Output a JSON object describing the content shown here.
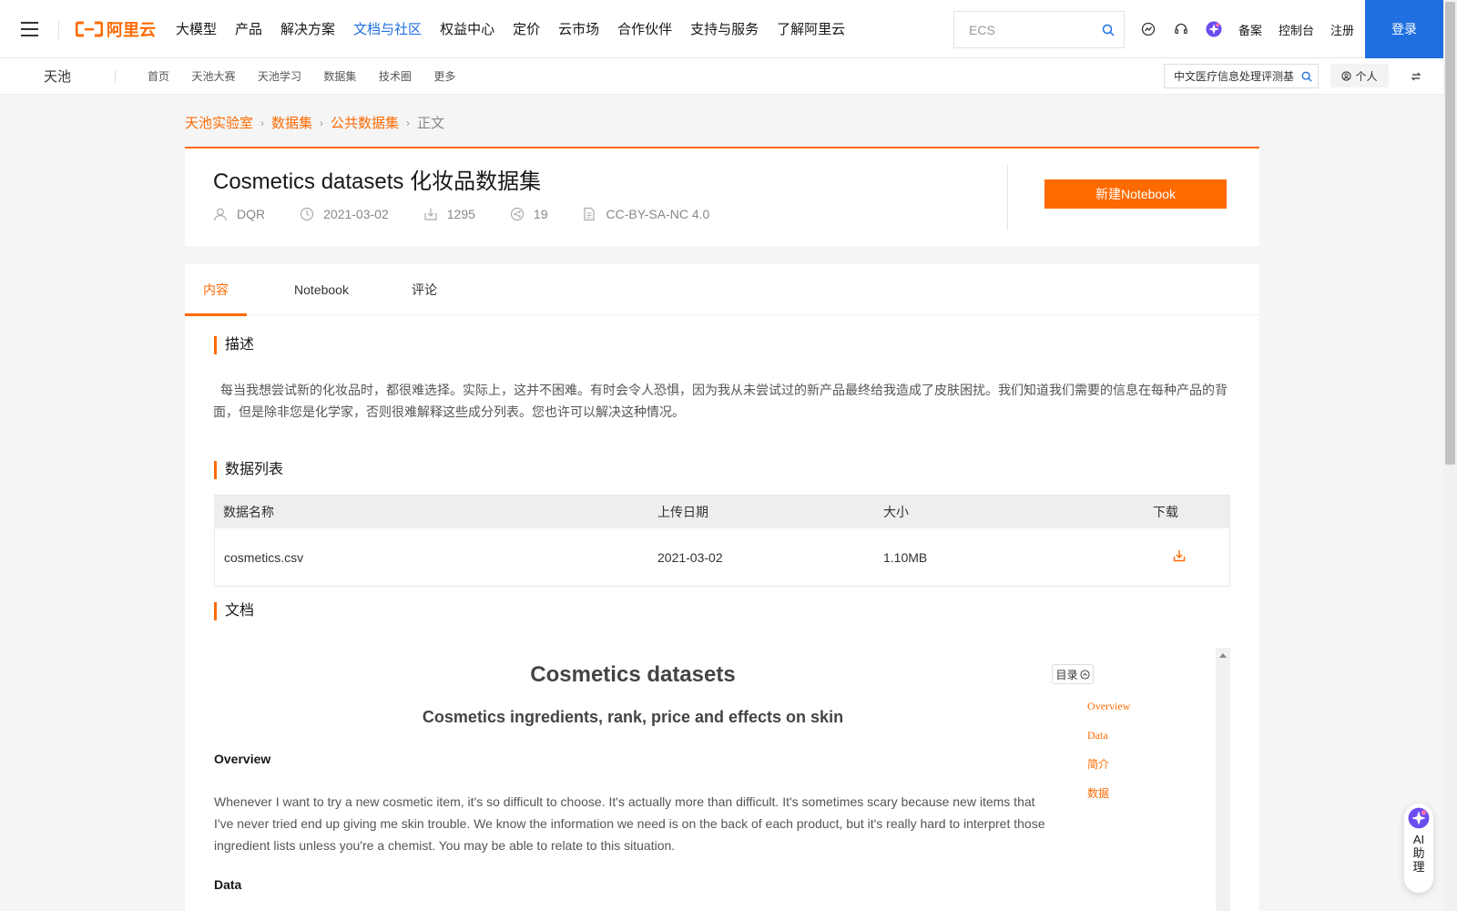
{
  "topnav": {
    "logo_text": "阿里云",
    "links": [
      "大模型",
      "产品",
      "解决方案",
      "文档与社区",
      "权益中心",
      "定价",
      "云市场",
      "合作伙伴",
      "支持与服务",
      "了解阿里云"
    ],
    "active_link": "文档与社区",
    "search_placeholder": "ECS",
    "right_links": [
      "备案",
      "控制台",
      "注册"
    ],
    "login_label": "登录",
    "brand_color": "#ff6a00",
    "accent_blue": "#1f6fe0"
  },
  "subnav": {
    "brand": "天池",
    "links": [
      "首页",
      "天池大赛",
      "天池学习",
      "数据集",
      "技术圈",
      "更多"
    ],
    "search_value": "中文医疗信息处理评测基",
    "personal_label": "个人"
  },
  "breadcrumb": {
    "items": [
      "天池实验室",
      "数据集",
      "公共数据集"
    ],
    "current": "正文"
  },
  "dataset": {
    "title": "Cosmetics datasets 化妆品数据集",
    "author": "DQR",
    "date": "2021-03-02",
    "downloads": "1295",
    "shares": "19",
    "license": "CC-BY-SA-NC 4.0",
    "new_notebook_label": "新建Notebook"
  },
  "tabs": [
    "内容",
    "Notebook",
    "评论"
  ],
  "active_tab": "内容",
  "sections": {
    "description_title": "描述",
    "description": "每当我想尝试新的化妆品时，都很难选择。实际上，这并不困难。有时会令人恐惧，因为我从未尝试过的新产品最终给我造成了皮肤困扰。我们知道我们需要的信息在每种产品的背面，但是除非您是化学家，否则很难解释这些成分列表。您也许可以解决这种情况。",
    "data_list_title": "数据列表",
    "doc_title": "文档"
  },
  "data_table": {
    "headers": [
      "数据名称",
      "上传日期",
      "大小",
      "下载"
    ],
    "rows": [
      {
        "name": "cosmetics.csv",
        "date": "2021-03-02",
        "size": "1.10MB"
      }
    ]
  },
  "document": {
    "h1": "Cosmetics datasets",
    "h2": "Cosmetics ingredients, rank, price and effects on skin",
    "overview_heading": "Overview",
    "overview_text": "Whenever I want to try a new cosmetic item, it's so difficult to choose. It's actually more than difficult. It's sometimes scary because new items that I've never tried end up giving me skin trouble. We know the information we need is on the back of each product, but it's really hard to interpret those ingredient lists unless you're a chemist. You may be able to relate to this situation.",
    "data_heading": "Data",
    "toc_label": "目录",
    "toc_items": [
      "Overview",
      "Data",
      "简介",
      "数据"
    ]
  },
  "ai_helper": {
    "label": "AI助理"
  }
}
